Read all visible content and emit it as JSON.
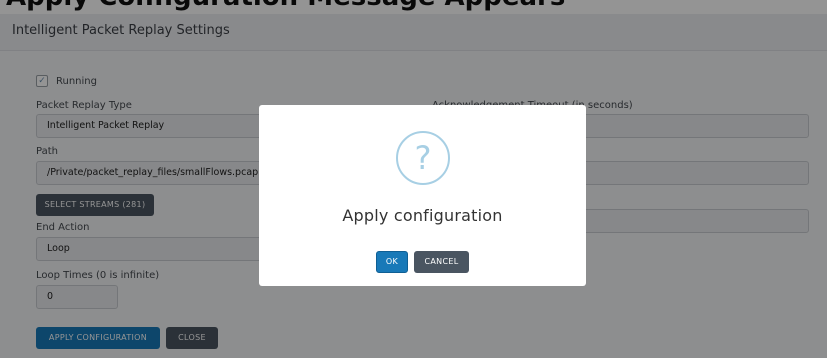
{
  "caption": "Apply Configuration Message Appears",
  "panel": {
    "title": "Intelligent Packet Replay Settings"
  },
  "form": {
    "running_label": "Running",
    "running_check": "✓",
    "replay_type_label": "Packet Replay Type",
    "replay_type_value": "Intelligent Packet Replay",
    "path_label": "Path",
    "path_value": "/Private/packet_replay_files/smallFlows.pcap",
    "select_streams_label": "SELECT STREAMS (281)",
    "end_action_label": "End Action",
    "end_action_value": "Loop",
    "loop_times_label": "Loop Times (0 is infinite)",
    "loop_times_value": "0",
    "ack_timeout_label": "Acknowledgement Timeout (in seconds)"
  },
  "footer": {
    "apply_label": "APPLY CONFIGURATION",
    "close_label": "CLOSE"
  },
  "modal": {
    "icon_glyph": "?",
    "title": "Apply configuration",
    "ok_label": "OK",
    "cancel_label": "CANCEL"
  },
  "colors": {
    "primary": "#1879b8",
    "secondary": "#4a5561",
    "icon": "#a7cfe4"
  }
}
